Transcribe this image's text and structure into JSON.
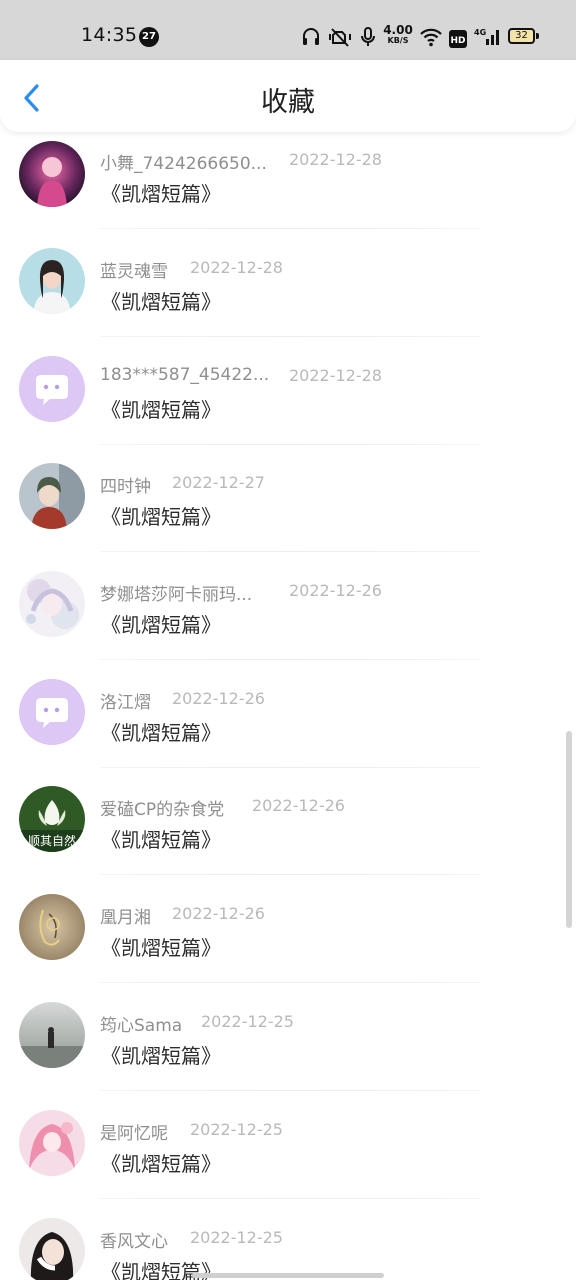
{
  "status_bar": {
    "time": "14:35",
    "notification_count": "27",
    "net_speed_value": "4.00",
    "net_speed_unit": "KB/S",
    "hd_label": "HD",
    "network_label": "4G",
    "battery": "32",
    "icons": [
      "headphones-icon",
      "vibrate-mute-icon",
      "mic-icon",
      "wifi-icon",
      "hd-icon",
      "signal-icon",
      "battery-icon"
    ]
  },
  "header": {
    "title": "收藏",
    "back_icon": "chevron-left-icon",
    "accent_color": "#2a8df0"
  },
  "items": [
    {
      "name": "小舞_7424266650...",
      "date": "2022-12-28",
      "title": "《凯熠短篇》",
      "avatar": "avatar-pink-anime"
    },
    {
      "name": "蓝灵魂雪",
      "date": "2022-12-28",
      "title": "《凯熠短篇》",
      "avatar": "avatar-girl-white-dress"
    },
    {
      "name": "183***587_45422...",
      "date": "2022-12-28",
      "title": "《凯熠短篇》",
      "avatar": "avatar-default-chat"
    },
    {
      "name": "四时钟",
      "date": "2022-12-27",
      "title": "《凯熠短篇》",
      "avatar": "avatar-boy-anime"
    },
    {
      "name": "梦娜塔莎阿卡丽玛...",
      "date": "2022-12-26",
      "title": "《凯熠短篇》",
      "avatar": "avatar-pale-anime"
    },
    {
      "name": "洛江熠",
      "date": "2022-12-26",
      "title": "《凯熠短篇》",
      "avatar": "avatar-default-chat"
    },
    {
      "name": "爱磕CP的杂食党",
      "date": "2022-12-26",
      "title": "《凯熠短篇》",
      "avatar": "avatar-lotus",
      "avatar_text": "顺其自然"
    },
    {
      "name": "凰月湘",
      "date": "2022-12-26",
      "title": "《凯熠短篇》",
      "avatar": "avatar-sepia-sketch"
    },
    {
      "name": "筠心Sama",
      "date": "2022-12-25",
      "title": "《凯熠短篇》",
      "avatar": "avatar-misty-figure"
    },
    {
      "name": "是阿忆呢",
      "date": "2022-12-25",
      "title": "《凯熠短篇》",
      "avatar": "avatar-pink-hair"
    },
    {
      "name": "香风文心",
      "date": "2022-12-25",
      "title": "《凯熠短篇》",
      "avatar": "avatar-dark-hair-girl"
    }
  ]
}
